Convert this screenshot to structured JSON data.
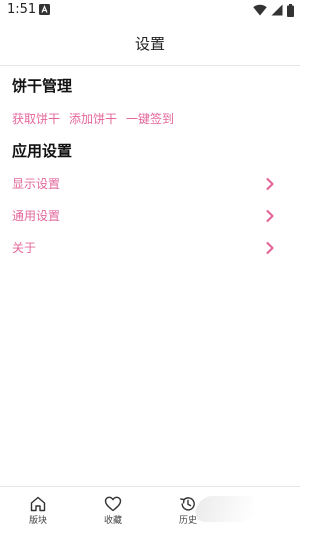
{
  "status_bar": {
    "time": "1:51",
    "notification_icon": "a-notification-icon",
    "icons": [
      "wifi-icon",
      "signal-icon",
      "battery-icon"
    ]
  },
  "header": {
    "title": "设置"
  },
  "sections": {
    "cookie": {
      "title": "饼干管理",
      "links": [
        "获取饼干",
        "添加饼干",
        "一键签到"
      ]
    },
    "app": {
      "title": "应用设置",
      "items": [
        {
          "label": "显示设置",
          "icon": "chevron-right-icon"
        },
        {
          "label": "通用设置",
          "icon": "chevron-right-icon"
        },
        {
          "label": "关于",
          "icon": "chevron-right-icon"
        }
      ]
    }
  },
  "bottom_nav": {
    "items": [
      {
        "label": "版块",
        "icon": "home-icon"
      },
      {
        "label": "收藏",
        "icon": "heart-icon"
      },
      {
        "label": "历史",
        "icon": "history-icon"
      }
    ]
  },
  "colors": {
    "accent": "#e4679b",
    "text": "#111111",
    "divider": "#e6e6e6"
  }
}
